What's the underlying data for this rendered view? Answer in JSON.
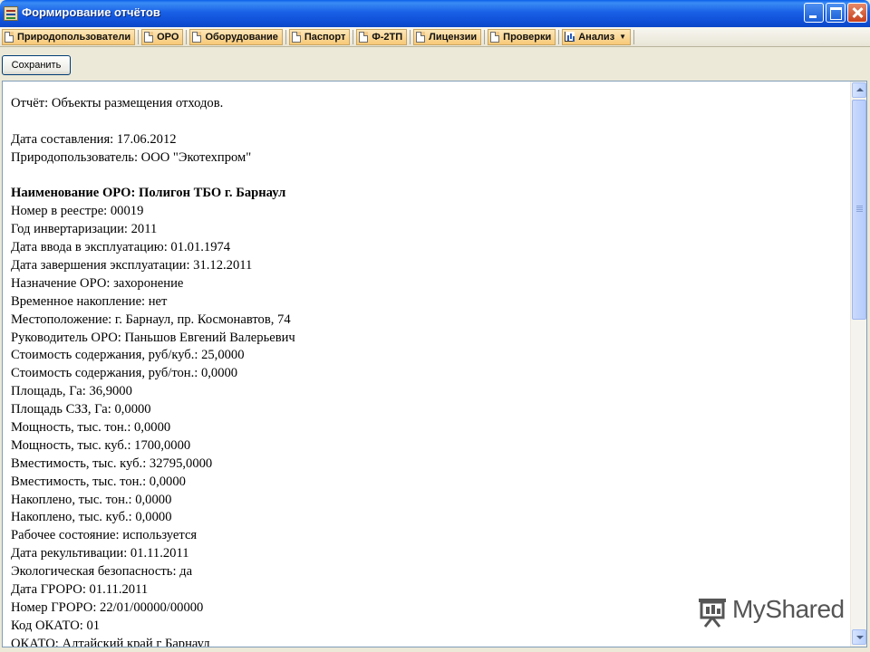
{
  "window": {
    "title": "Формирование отчётов"
  },
  "tabs": [
    {
      "label": "Природопользователи",
      "icon": "document-icon"
    },
    {
      "label": "ОРО",
      "icon": "document-icon"
    },
    {
      "label": "Оборудование",
      "icon": "document-icon"
    },
    {
      "label": "Паспорт",
      "icon": "document-icon"
    },
    {
      "label": "Ф-2ТП",
      "icon": "document-icon"
    },
    {
      "label": "Лицензии",
      "icon": "document-icon"
    },
    {
      "label": "Проверки",
      "icon": "document-icon"
    },
    {
      "label": "Анализ",
      "icon": "chart-icon"
    }
  ],
  "toolbar": {
    "save_label": "Сохранить"
  },
  "report": {
    "lines": [
      {
        "text": "Отчёт: Объекты размещения отходов.",
        "bold": false
      },
      {
        "text": "",
        "bold": false
      },
      {
        "text": "Дата составления: 17.06.2012",
        "bold": false
      },
      {
        "text": "Природопользователь: ООО \"Экотехпром\"",
        "bold": false
      },
      {
        "text": "",
        "bold": false
      },
      {
        "text": "Наименование ОРО: Полигон ТБО г. Барнаул",
        "bold": true
      },
      {
        "text": "Номер в реестре: 00019",
        "bold": false
      },
      {
        "text": "Год инвертаризации: 2011",
        "bold": false
      },
      {
        "text": "Дата ввода в эксплуатацию: 01.01.1974",
        "bold": false
      },
      {
        "text": "Дата завершения эксплуатации: 31.12.2011",
        "bold": false
      },
      {
        "text": "Назначение ОРО: захоронение",
        "bold": false
      },
      {
        "text": "Временное накопление: нет",
        "bold": false
      },
      {
        "text": "Местоположение: г. Барнаул, пр. Космонавтов, 74",
        "bold": false
      },
      {
        "text": "Руководитель ОРО: Паньшов Евгений Валерьевич",
        "bold": false
      },
      {
        "text": "Стоимость содержания, руб/куб.: 25,0000",
        "bold": false
      },
      {
        "text": "Стоимость содержания, руб/тон.: 0,0000",
        "bold": false
      },
      {
        "text": "Площадь, Га: 36,9000",
        "bold": false
      },
      {
        "text": "Площадь СЗЗ, Га: 0,0000",
        "bold": false
      },
      {
        "text": "Мощность, тыс. тон.: 0,0000",
        "bold": false
      },
      {
        "text": "Мощность, тыс. куб.: 1700,0000",
        "bold": false
      },
      {
        "text": "Вместимость, тыс. куб.: 32795,0000",
        "bold": false
      },
      {
        "text": "Вместимость, тыс. тон.: 0,0000",
        "bold": false
      },
      {
        "text": "Накоплено, тыс. тон.: 0,0000",
        "bold": false
      },
      {
        "text": "Накоплено, тыс. куб.: 0,0000",
        "bold": false
      },
      {
        "text": "Рабочее состояние: используется",
        "bold": false
      },
      {
        "text": "Дата рекультивации: 01.11.2011",
        "bold": false
      },
      {
        "text": "Экологическая безопасность: да",
        "bold": false
      },
      {
        "text": "Дата ГРОРО: 01.11.2011",
        "bold": false
      },
      {
        "text": "Номер ГРОРО: 22/01/00000/00000",
        "bold": false
      },
      {
        "text": "Код ОКАТО: 01",
        "bold": false
      },
      {
        "text": "ОКАТО: Алтайский край г Барнаул",
        "bold": false
      }
    ]
  },
  "watermark": {
    "text": "MyShared"
  }
}
